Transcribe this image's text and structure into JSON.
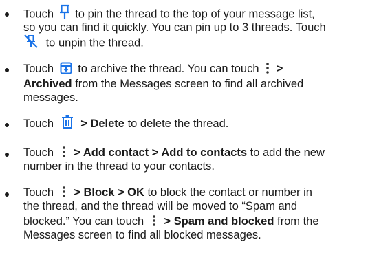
{
  "icons": {
    "accent": "#1a73e8",
    "dots": "#333333",
    "pin": "pin-icon",
    "unpin": "unpin-icon",
    "archive": "archive-icon",
    "delete": "delete-icon",
    "menu": "more-vert-icon"
  },
  "items": [
    {
      "touch": "Touch",
      "l1_after": "to pin the thread to the top of your message list,",
      "l2": "so you can find it quickly. You can pin up to 3 threads. Touch",
      "l3_after": "to unpin the thread."
    },
    {
      "touch": "Touch",
      "l1_mid": "to archive the thread. You can touch",
      "l1_gt": ">",
      "l2_bold": "Archived",
      "l2_after": "from the Messages screen to find all archived",
      "l3": "messages."
    },
    {
      "touch": "Touch",
      "l1_bold": "> Delete",
      "l1_after": "to delete the thread."
    },
    {
      "touch": "Touch",
      "l1_bold": "> Add contact > Add to contacts",
      "l1_after": "to add the new",
      "l2": "number in the thread to your contacts."
    },
    {
      "touch": "Touch",
      "l1_bold": "> Block > OK",
      "l1_after": "to block the contact or number in",
      "l2": "the thread, and the thread will be moved to “Spam and",
      "l3_before": "blocked.” You can touch",
      "l3_bold": "> Spam and blocked",
      "l3_after": "from the",
      "l4": "Messages screen to find all blocked messages."
    }
  ]
}
